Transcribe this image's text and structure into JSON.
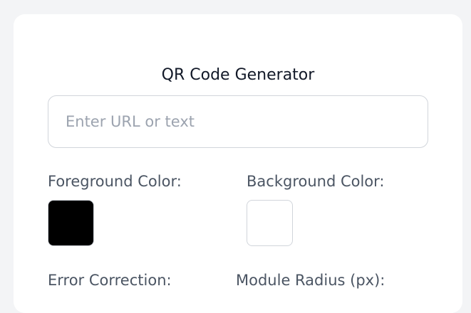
{
  "title": "QR Code Generator",
  "url_input": {
    "value": "",
    "placeholder": "Enter URL or text"
  },
  "foreground": {
    "label": "Foreground Color:",
    "color": "#000000"
  },
  "background": {
    "label": "Background Color:",
    "color": "#ffffff"
  },
  "error_correction": {
    "label": "Error Correction:"
  },
  "module_radius": {
    "label": "Module Radius (px):"
  }
}
